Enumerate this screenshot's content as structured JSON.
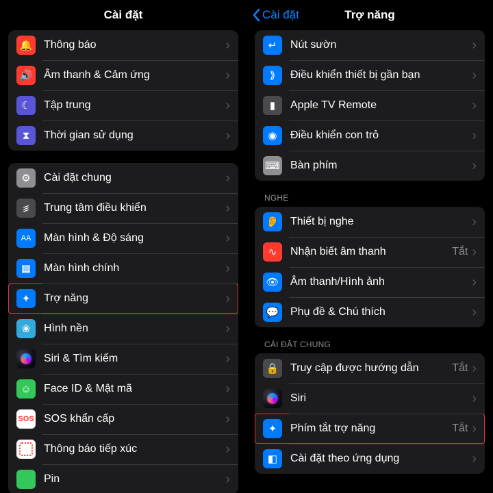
{
  "left": {
    "title": "Cài đặt",
    "group1": [
      {
        "name": "notifications",
        "label": "Thông báo",
        "iconClass": "bg-red",
        "glyph": "🔔"
      },
      {
        "name": "sounds",
        "label": "Âm thanh & Cảm ứng",
        "iconClass": "bg-red",
        "glyph": "🔊"
      },
      {
        "name": "focus",
        "label": "Tập trung",
        "iconClass": "bg-purple",
        "glyph": "☾"
      },
      {
        "name": "screen-time",
        "label": "Thời gian sử dụng",
        "iconClass": "bg-purple",
        "glyph": "⧗"
      }
    ],
    "group2": [
      {
        "name": "general",
        "label": "Cài đặt chung",
        "iconClass": "bg-gray",
        "glyph": "⚙"
      },
      {
        "name": "control-center",
        "label": "Trung tâm điều khiển",
        "iconClass": "bg-darkgray",
        "glyph": "꠵"
      },
      {
        "name": "display",
        "label": "Màn hình & Độ sáng",
        "iconClass": "bg-blue",
        "glyph": "AA"
      },
      {
        "name": "home-screen",
        "label": "Màn hình chính",
        "iconClass": "bg-blue",
        "glyph": "▦"
      },
      {
        "name": "accessibility",
        "label": "Trợ năng",
        "iconClass": "bg-blue",
        "glyph": "✦",
        "highlight": true
      },
      {
        "name": "wallpaper",
        "label": "Hình nền",
        "iconClass": "bg-cyan",
        "glyph": "❀"
      },
      {
        "name": "siri",
        "label": "Siri & Tìm kiếm",
        "iconClass": "siri",
        "glyph": ""
      },
      {
        "name": "faceid",
        "label": "Face ID & Mật mã",
        "iconClass": "faceid",
        "glyph": "☺"
      },
      {
        "name": "sos",
        "label": "SOS khẩn cấp",
        "iconClass": "sos",
        "glyph": "SOS"
      },
      {
        "name": "exposure",
        "label": "Thông báo tiếp xúc",
        "iconClass": "exposure",
        "glyph": ""
      },
      {
        "name": "battery",
        "label": "Pin",
        "iconClass": "bg-green",
        "glyph": ""
      }
    ]
  },
  "right": {
    "title": "Trợ năng",
    "back": "Cài đặt",
    "group1": [
      {
        "name": "side-button",
        "label": "Nút sườn",
        "iconClass": "bg-blue",
        "glyph": "↵"
      },
      {
        "name": "nearby",
        "label": "Điều khiển thiết bị gần bạn",
        "iconClass": "bg-blue",
        "glyph": "⟫"
      },
      {
        "name": "apple-tv",
        "label": "Apple TV Remote",
        "iconClass": "bg-darkgray",
        "glyph": "▮"
      },
      {
        "name": "pointer",
        "label": "Điều khiển con trỏ",
        "iconClass": "bg-blue",
        "glyph": "◉"
      },
      {
        "name": "keyboard",
        "label": "Bàn phím",
        "iconClass": "bg-gray",
        "glyph": "⌨"
      }
    ],
    "hearingHeader": "NGHE",
    "group2": [
      {
        "name": "hearing-devices",
        "label": "Thiết bị nghe",
        "iconClass": "bg-blue",
        "glyph": "👂"
      },
      {
        "name": "sound-recognition",
        "label": "Nhận biết âm thanh",
        "iconClass": "bg-red",
        "glyph": "∿",
        "value": "Tắt"
      },
      {
        "name": "audio-visual",
        "label": "Âm thanh/Hình ảnh",
        "iconClass": "bg-blue",
        "glyph": "👁"
      },
      {
        "name": "subtitles",
        "label": "Phụ đề & Chú thích",
        "iconClass": "bg-blue",
        "glyph": "💬"
      }
    ],
    "generalHeader": "CÀI ĐẶT CHUNG",
    "group3": [
      {
        "name": "guided-access",
        "label": "Truy cập được hướng dẫn",
        "iconClass": "bg-darkgray",
        "glyph": "🔒",
        "value": "Tắt"
      },
      {
        "name": "siri-accessibility",
        "label": "Siri",
        "iconClass": "siri",
        "glyph": ""
      },
      {
        "name": "accessibility-shortcut",
        "label": "Phím tắt trợ năng",
        "iconClass": "bg-blue",
        "glyph": "✦",
        "value": "Tắt",
        "highlight": true
      },
      {
        "name": "per-app",
        "label": "Cài đặt theo ứng dụng",
        "iconClass": "bg-blue",
        "glyph": "◧"
      }
    ]
  }
}
